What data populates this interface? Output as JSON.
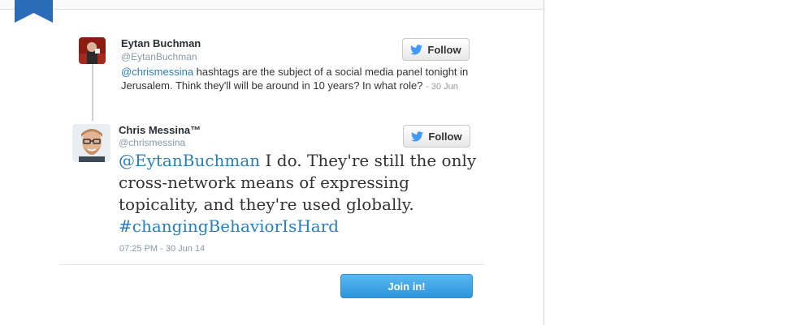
{
  "reply_tweet": {
    "name": "Eytan Buchman",
    "handle": "@EytanBuchman",
    "mention": "@chrismessina",
    "text": " hashtags are the subject of a social media panel tonight in Jerusalem. Think they'll will be around in 10 years? In what role?",
    "date": "- 30 Jun",
    "follow_label": "Follow"
  },
  "main_tweet": {
    "name": "Chris Messina™",
    "handle": "@chrismessina",
    "mention": "@EytanBuchman",
    "text": " I do. They're still the only cross-network means of expressing topicality, and they're used globally. ",
    "hashtag": "#changingBehaviorIsHard",
    "timestamp": "07:25 PM - 30 Jun 14",
    "follow_label": "Follow"
  },
  "cta": {
    "join_label": "Join in!"
  },
  "colors": {
    "link": "#2a7fb8",
    "button_blue": "#2b95dd",
    "ribbon": "#2a6cb8"
  },
  "icons": [
    "bookmark-ribbon-icon",
    "twitter-bird-icon"
  ]
}
